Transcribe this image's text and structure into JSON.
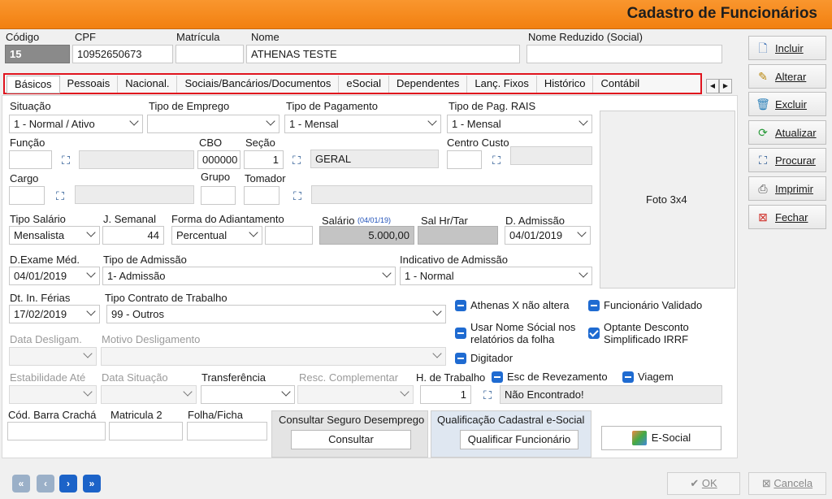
{
  "window": {
    "title": "Cadastro de Funcionários"
  },
  "header": {
    "codigo": {
      "label": "Código",
      "value": "15"
    },
    "cpf": {
      "label": "CPF",
      "value": "10952650673"
    },
    "matricula": {
      "label": "Matrícula",
      "value": ""
    },
    "nome": {
      "label": "Nome",
      "value": "ATHENAS TESTE"
    },
    "nome_reduzido": {
      "label": "Nome Reduzido (Social)",
      "value": ""
    }
  },
  "tabs": [
    "Básicos",
    "Pessoais",
    "Nacional.",
    "Sociais/Bancários/Documentos",
    "eSocial",
    "Dependentes",
    "Lanç. Fixos",
    "Histórico",
    "Contábil"
  ],
  "active_tab": "Básicos",
  "side_buttons": {
    "incluir": "Incluir",
    "alterar": "Alterar",
    "excluir": "Excluir",
    "atualizar": "Atualizar",
    "procurar": "Procurar",
    "imprimir": "Imprimir",
    "fechar": "Fechar"
  },
  "form": {
    "situacao": {
      "label": "Situação",
      "value": "1 - Normal / Ativo"
    },
    "tipo_emprego": {
      "label": "Tipo de Emprego",
      "value": ""
    },
    "tipo_pagamento": {
      "label": "Tipo de Pagamento",
      "value": "1 - Mensal"
    },
    "tipo_pag_rais": {
      "label": "Tipo de Pag. RAIS",
      "value": "1 - Mensal"
    },
    "funcao": {
      "label": "Função",
      "value": ""
    },
    "cbo": {
      "label": "CBO",
      "value": "000000"
    },
    "secao": {
      "label": "Seção",
      "value": "1",
      "desc": "GERAL"
    },
    "centro_custo": {
      "label": "Centro Custo",
      "value": ""
    },
    "cargo": {
      "label": "Cargo",
      "value": ""
    },
    "grupo": {
      "label": "Grupo",
      "value": ""
    },
    "tomador": {
      "label": "Tomador",
      "value": ""
    },
    "foto": "Foto 3x4",
    "tipo_salario": {
      "label": "Tipo Salário",
      "value": "Mensalista"
    },
    "j_semanal": {
      "label": "J. Semanal",
      "value": "44"
    },
    "forma_adiantamento": {
      "label": "Forma do Adiantamento",
      "value": "Percentual"
    },
    "salario": {
      "label": "Salário",
      "date": "(04/01/19)",
      "value": "5.000,00"
    },
    "sal_hr_tar": {
      "label": "Sal Hr/Tar",
      "value": ""
    },
    "d_admissao": {
      "label": "D. Admissão",
      "value": "04/01/2019"
    },
    "d_exame_med": {
      "label": "D.Exame Méd.",
      "value": "04/01/2019"
    },
    "tipo_admissao": {
      "label": "Tipo de Admissão",
      "value": "1- Admissão"
    },
    "indicativo_admissao": {
      "label": "Indicativo de Admissão",
      "value": "1 - Normal"
    },
    "dt_in_ferias": {
      "label": "Dt. In. Férias",
      "value": "17/02/2019"
    },
    "tipo_contrato": {
      "label": "Tipo Contrato de Trabalho",
      "value": "99 - Outros"
    },
    "data_desligam": {
      "label": "Data Desligam."
    },
    "motivo_desligamento": {
      "label": "Motivo Desligamento"
    },
    "estabilidade_ate": {
      "label": "Estabilidade Até"
    },
    "data_situacao": {
      "label": "Data Situação"
    },
    "transferencia": {
      "label": "Transferência"
    },
    "resc_complementar": {
      "label": "Resc. Complementar"
    },
    "h_trabalho": {
      "label": "H. de Trabalho",
      "value": "1",
      "desc": "Não Encontrado!"
    },
    "cod_barra_cracha": {
      "label": "Cód. Barra Crachá"
    },
    "matricula2": {
      "label": "Matricula 2"
    },
    "folha_ficha": {
      "label": "Folha/Ficha"
    }
  },
  "checkboxes": {
    "athenas_x": "Athenas X não altera",
    "func_validado": "Funcionário Validado",
    "nome_social_l1": "Usar Nome Sócial nos",
    "nome_social_l2": "relatórios da folha",
    "optante_l1": "Optante Desconto",
    "optante_l2": "Simplificado IRRF",
    "digitador": "Digitador",
    "esc_revezamento": "Esc de Revezamento",
    "viagem": "Viagem"
  },
  "seguro_desemprego": {
    "title": "Consultar Seguro Desemprego",
    "button": "Consultar"
  },
  "qualificacao": {
    "title": "Qualificação Cadastral e-Social",
    "button": "Qualificar Funcionário"
  },
  "esocial_button": "E-Social",
  "footer": {
    "ok": "OK",
    "cancela": "Cancela"
  }
}
